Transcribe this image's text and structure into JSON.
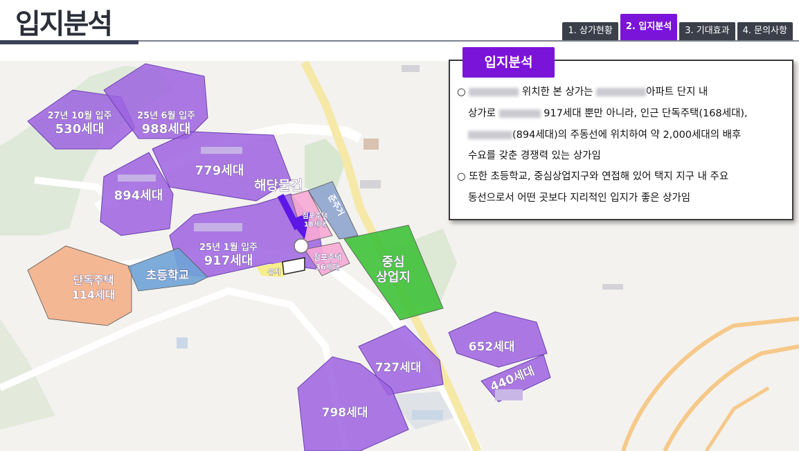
{
  "header": {
    "title": "입지분석",
    "tabs": [
      {
        "label": "1. 상가현황",
        "active": false
      },
      {
        "label": "2. 입지분석",
        "active": true
      },
      {
        "label": "3. 기대효과",
        "active": false
      },
      {
        "label": "4. 문의사항",
        "active": false
      }
    ]
  },
  "info_box": {
    "badge": "입지분석",
    "lines": [
      "○ ",
      "위치한 본 상가는 ",
      "아파트 단지 내",
      "상가로 ",
      " 917세대 뿐만 아니라, 인근 단독주택(168세대),",
      "(894세대)의 주동선에 위치하여 약 2,000세대의 배후",
      "수요를 갖춘 경쟁력 있는 상가임",
      "○ 또한 초등학교, 중심상업지구와 연접해 있어 택지 지구 내 주요",
      "동선으로서 어떤 곳보다 지리적인 입지가 좋은 상가임"
    ]
  },
  "map": {
    "labels": {
      "a530_top": "27년 10월 입주",
      "a530": "530세대",
      "a988_top": "25년 6월 입주",
      "a988": "988세대",
      "a779": "779세대",
      "a894": "894세대",
      "a917_top": "25년 1월 입주",
      "a917": "917세대",
      "target": "해당물건",
      "shop1": "점포주택",
      "shop1b": "18세대",
      "shop2": "점포주택",
      "shop2b": "36세대",
      "residential": "준주거",
      "center1": "중심",
      "center2": "상업지",
      "single1": "단독주택",
      "single2": "114세대",
      "school": "초등학교",
      "kinder": "유치",
      "a652": "652세대",
      "a727": "727세대",
      "a440": "440세대",
      "a798": "798세대"
    },
    "colors": {
      "apartment": "#9d63e0",
      "single": "#f4b088",
      "school": "#6fa3d6",
      "commercial": "#3fc23a",
      "shop": "#f7a8d5",
      "residential": "#8fa5cf",
      "road_main": "#f6e8a6",
      "arrow": "#5c17e6"
    }
  }
}
